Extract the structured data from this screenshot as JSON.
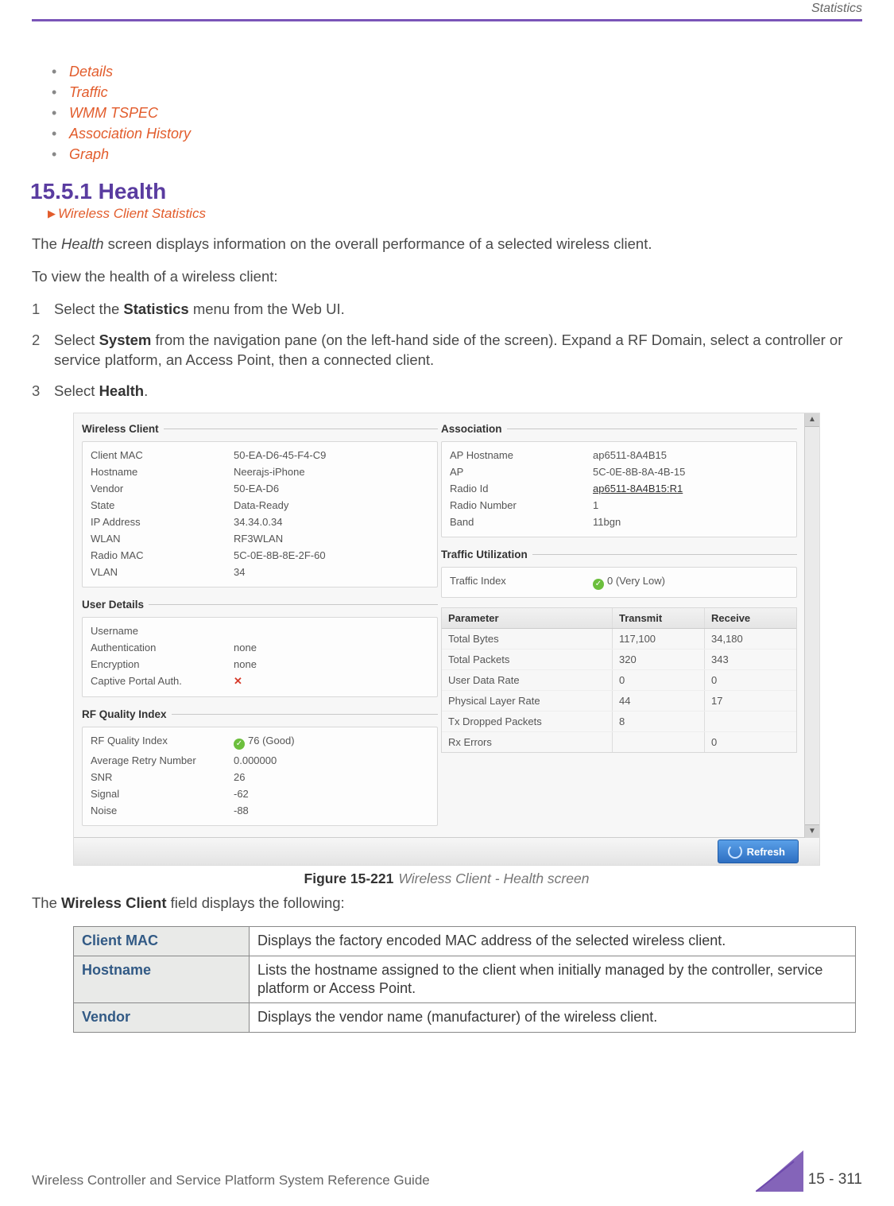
{
  "header": {
    "chapter": "Statistics"
  },
  "bullets": [
    "Details",
    "Traffic",
    "WMM TSPEC",
    "Association History",
    "Graph"
  ],
  "section": {
    "number_title": "15.5.1 Health",
    "breadcrumb": "Wireless Client Statistics"
  },
  "paras": {
    "intro_pre": "The ",
    "intro_ital": "Health",
    "intro_post": " screen displays information on the overall performance of a selected wireless client.",
    "howto": "To view the health of a wireless client:"
  },
  "steps": [
    {
      "pre": "Select the ",
      "bold": "Statistics",
      "post": " menu from the Web UI."
    },
    {
      "pre": "Select ",
      "bold": "System",
      "post": " from the navigation pane (on the left-hand side of the screen). Expand a RF Domain, select a controller or service platform, an Access Point, then a connected client."
    },
    {
      "pre": "Select ",
      "bold": "Health",
      "post": "."
    }
  ],
  "fig": {
    "wireless_client_title": "Wireless Client",
    "association_title": "Association",
    "user_details_title": "User Details",
    "rf_quality_title": "RF Quality Index",
    "traffic_util_title": "Traffic Utilization",
    "wc": {
      "Client MAC": "50-EA-D6-45-F4-C9",
      "Hostname": "Neerajs-iPhone",
      "Vendor": "50-EA-D6",
      "State": "Data-Ready",
      "IP Address": "34.34.0.34",
      "WLAN": " RF3WLAN",
      "Radio MAC": "5C-0E-8B-8E-2F-60",
      "VLAN": "34"
    },
    "assoc": {
      "AP Hostname": "ap6511-8A4B15",
      "AP": "5C-0E-8B-8A-4B-15",
      "Radio Id": "ap6511-8A4B15:R1",
      "Radio Number": "1",
      "Band": "11bgn"
    },
    "ud": {
      "Username": "",
      "Authentication": "none",
      "Encryption": "none",
      "Captive Portal Auth.": "No"
    },
    "rfq": {
      "RF Quality Index": "76 (Good)",
      "Average Retry Number": "0.000000",
      "SNR": "26",
      "Signal": "-62",
      "Noise": "-88"
    },
    "tu_index": {
      "label": "Traffic Index",
      "value": "0 (Very Low)"
    },
    "tu_headers": [
      "Parameter",
      "Transmit",
      "Receive"
    ],
    "tu_rows": [
      [
        "Total Bytes",
        "117,100",
        "34,180"
      ],
      [
        "Total Packets",
        "320",
        "343"
      ],
      [
        "User Data Rate",
        "0",
        "0"
      ],
      [
        "Physical Layer Rate",
        "44",
        "17"
      ],
      [
        "Tx Dropped Packets",
        "8",
        ""
      ],
      [
        "Rx Errors",
        "",
        "0"
      ]
    ],
    "refresh": "Refresh",
    "caption_num": "Figure 15-221",
    "caption_txt": "Wireless Client - Health screen"
  },
  "table_intro": {
    "pre": "The ",
    "bold": "Wireless Client",
    "post": " field displays the following:"
  },
  "desc_table": [
    {
      "k": "Client MAC",
      "v": "Displays the factory encoded MAC address of the selected wireless client."
    },
    {
      "k": "Hostname",
      "v": "Lists the hostname assigned to the client when initially managed by the controller, service platform or Access Point."
    },
    {
      "k": "Vendor",
      "v": "Displays the vendor name (manufacturer) of the wireless client."
    }
  ],
  "footer": {
    "left": "Wireless Controller and Service Platform System Reference Guide",
    "right": "15 - 311"
  }
}
